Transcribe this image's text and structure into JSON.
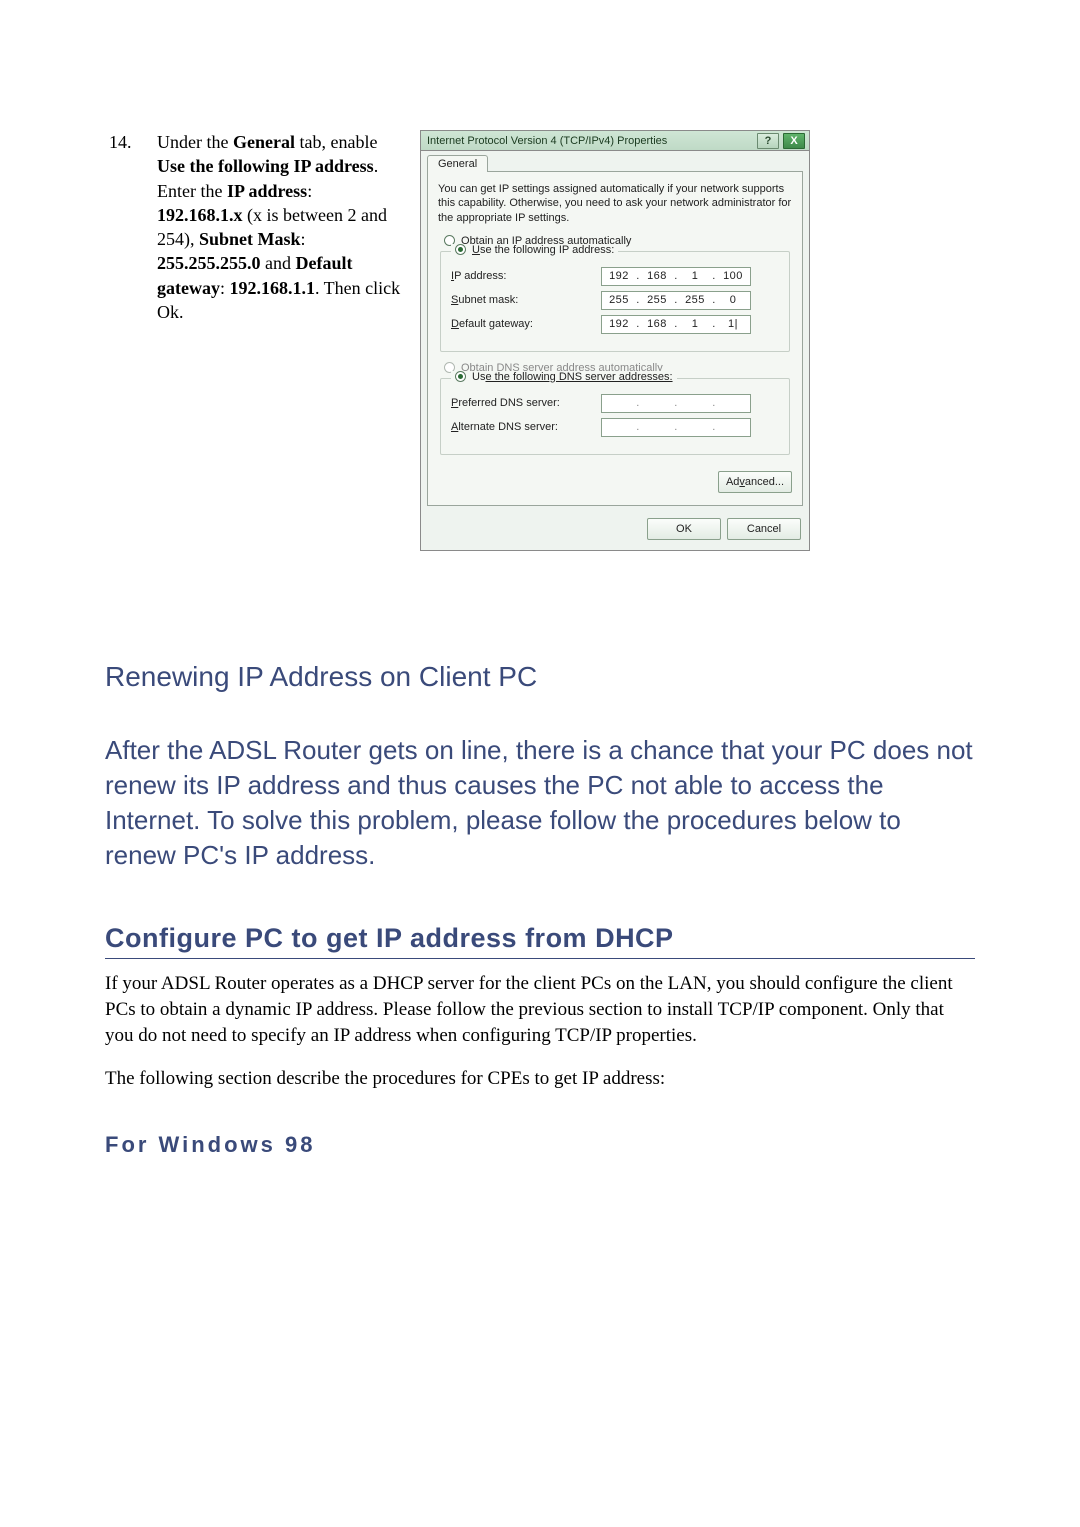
{
  "step": {
    "num": "14.",
    "t1": "Under the ",
    "b1": "General",
    "t2": " tab, enable ",
    "b2": "Use the following IP address",
    "t3": ". Enter the ",
    "b3": "IP address",
    "t4": ": ",
    "b4": "192.168.1.x",
    "t5": " (x is between 2 and 254), ",
    "b5": "Subnet Mask",
    "t6": ": ",
    "b6": "255.255.255.0",
    "t7": " and ",
    "b7": "Default gateway",
    "t8": ": ",
    "b8": "192.168.1.1",
    "t9": ". Then click Ok."
  },
  "dlg": {
    "title": "Internet Protocol Version 4 (TCP/IPv4) Properties",
    "tab": "General",
    "intro": "You can get IP settings assigned automatically if your network supports this capability. Otherwise, you need to ask your network administrator for the appropriate IP settings.",
    "r1a": "O",
    "r1b": "btain an IP address automatically",
    "r2a": "U",
    "r2b": "se the following IP address:",
    "f_ip_l1": "I",
    "f_ip_l2": "P address:",
    "f_sm_l1": "S",
    "f_sm_l2": "ubnet mask:",
    "f_gw_l1": "D",
    "f_gw_l2": "efault gateway:",
    "ip": {
      "a": "192",
      "b": "168",
      "c": "1",
      "d": "100"
    },
    "sm": {
      "a": "255",
      "b": "255",
      "c": "255",
      "d": "0"
    },
    "gw": {
      "a": "192",
      "b": "168",
      "c": "1",
      "d": "1|"
    },
    "r3a": "Obtain DNS server address automatically",
    "r4a": "Us",
    "r4b": "e the following DNS server addresses:",
    "f_pd_l1": "P",
    "f_pd_l2": "referred DNS server:",
    "f_ad_l1": "A",
    "f_ad_l2": "lternate DNS server:",
    "adv1": "Ad",
    "adv2": "v",
    "adv3": "anced...",
    "ok": "OK",
    "cancel": "Cancel",
    "dots": "."
  },
  "sections": {
    "h_renew": "Renewing IP Address on Client PC",
    "p_renew": "After the ADSL Router gets on line, there is a chance that your PC does not renew its IP address and thus causes the PC not able to access the Internet. To solve this problem, please follow the procedures below to renew PC's IP address.",
    "h_dhcp": "Configure PC to get IP address from DHCP",
    "p_dhcp": "If your ADSL Router operates as a DHCP server for the client PCs on the LAN, you should configure the client PCs to obtain a dynamic IP address. Please follow the previous section to install TCP/IP component. Only that you do not need to specify an IP address when configuring TCP/IP properties.",
    "p_cpe": "The following section describe the procedures for CPEs to get IP address:",
    "h_win98": "For Windows 98"
  }
}
